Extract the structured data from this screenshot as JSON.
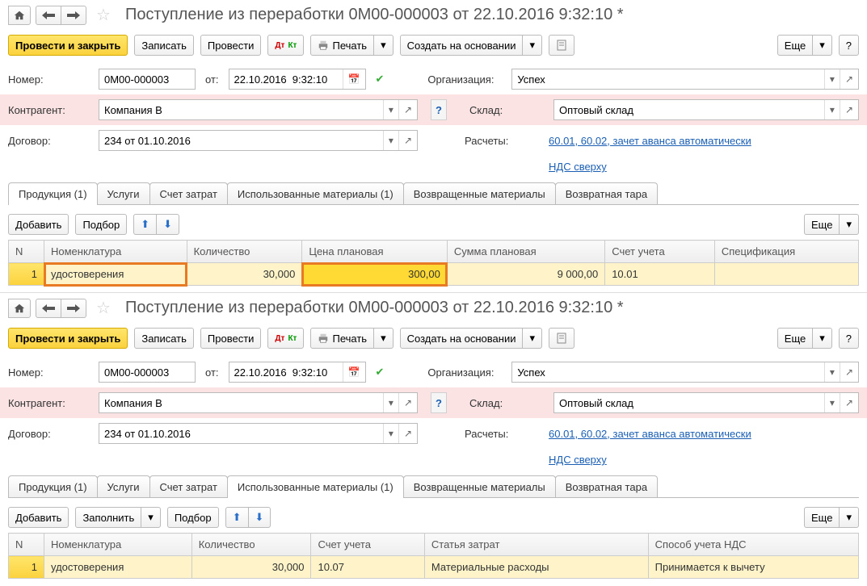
{
  "doc1": {
    "title": "Поступление из переработки 0М00-000003 от 22.10.2016 9:32:10 *",
    "toolbar": {
      "post_close": "Провести и закрыть",
      "write": "Записать",
      "post": "Провести",
      "print": "Печать",
      "create_based": "Создать на основании",
      "more": "Еще"
    },
    "fields": {
      "number_lbl": "Номер:",
      "number": "0М00-000003",
      "from_lbl": "от:",
      "date": "22.10.2016  9:32:10",
      "org_lbl": "Организация:",
      "org": "Успех",
      "contr_lbl": "Контрагент:",
      "contr": "Компания В",
      "warehouse_lbl": "Склад:",
      "warehouse": "Оптовый склад",
      "contract_lbl": "Договор:",
      "contract": "234 от 01.10.2016",
      "settlements_lbl": "Расчеты:",
      "settlements": "60.01, 60.02, зачет аванса автоматически",
      "vat": "НДС сверху"
    },
    "tabs": [
      "Продукция (1)",
      "Услуги",
      "Счет затрат",
      "Использованные материалы (1)",
      "Возвращенные материалы",
      "Возвратная тара"
    ],
    "active_tab": 0,
    "tab_toolbar": {
      "add": "Добавить",
      "pick": "Подбор",
      "more": "Еще"
    },
    "table": {
      "cols": [
        "N",
        "Номенклатура",
        "Количество",
        "Цена плановая",
        "Сумма плановая",
        "Счет учета",
        "Спецификация"
      ],
      "rows": [
        {
          "n": "1",
          "nomen": "удостоверения",
          "qty": "30,000",
          "price": "300,00",
          "sum": "9 000,00",
          "account": "10.01",
          "spec": ""
        }
      ]
    }
  },
  "doc2": {
    "title": "Поступление из переработки 0М00-000003 от 22.10.2016 9:32:10 *",
    "toolbar": {
      "post_close": "Провести и закрыть",
      "write": "Записать",
      "post": "Провести",
      "print": "Печать",
      "create_based": "Создать на основании",
      "more": "Еще"
    },
    "fields": {
      "number_lbl": "Номер:",
      "number": "0М00-000003",
      "from_lbl": "от:",
      "date": "22.10.2016  9:32:10",
      "org_lbl": "Организация:",
      "org": "Успех",
      "contr_lbl": "Контрагент:",
      "contr": "Компания В",
      "warehouse_lbl": "Склад:",
      "warehouse": "Оптовый склад",
      "contract_lbl": "Договор:",
      "contract": "234 от 01.10.2016",
      "settlements_lbl": "Расчеты:",
      "settlements": "60.01, 60.02, зачет аванса автоматически",
      "vat": "НДС сверху"
    },
    "tabs": [
      "Продукция (1)",
      "Услуги",
      "Счет затрат",
      "Использованные материалы (1)",
      "Возвращенные материалы",
      "Возвратная тара"
    ],
    "active_tab": 3,
    "tab_toolbar": {
      "add": "Добавить",
      "fill": "Заполнить",
      "pick": "Подбор",
      "more": "Еще"
    },
    "table": {
      "cols": [
        "N",
        "Номенклатура",
        "Количество",
        "Счет учета",
        "Статья затрат",
        "Способ учета НДС"
      ],
      "rows": [
        {
          "n": "1",
          "nomen": "удостоверения",
          "qty": "30,000",
          "account": "10.07",
          "cost_item": "Материальные расходы",
          "vat_mode": "Принимается к вычету"
        }
      ]
    }
  }
}
